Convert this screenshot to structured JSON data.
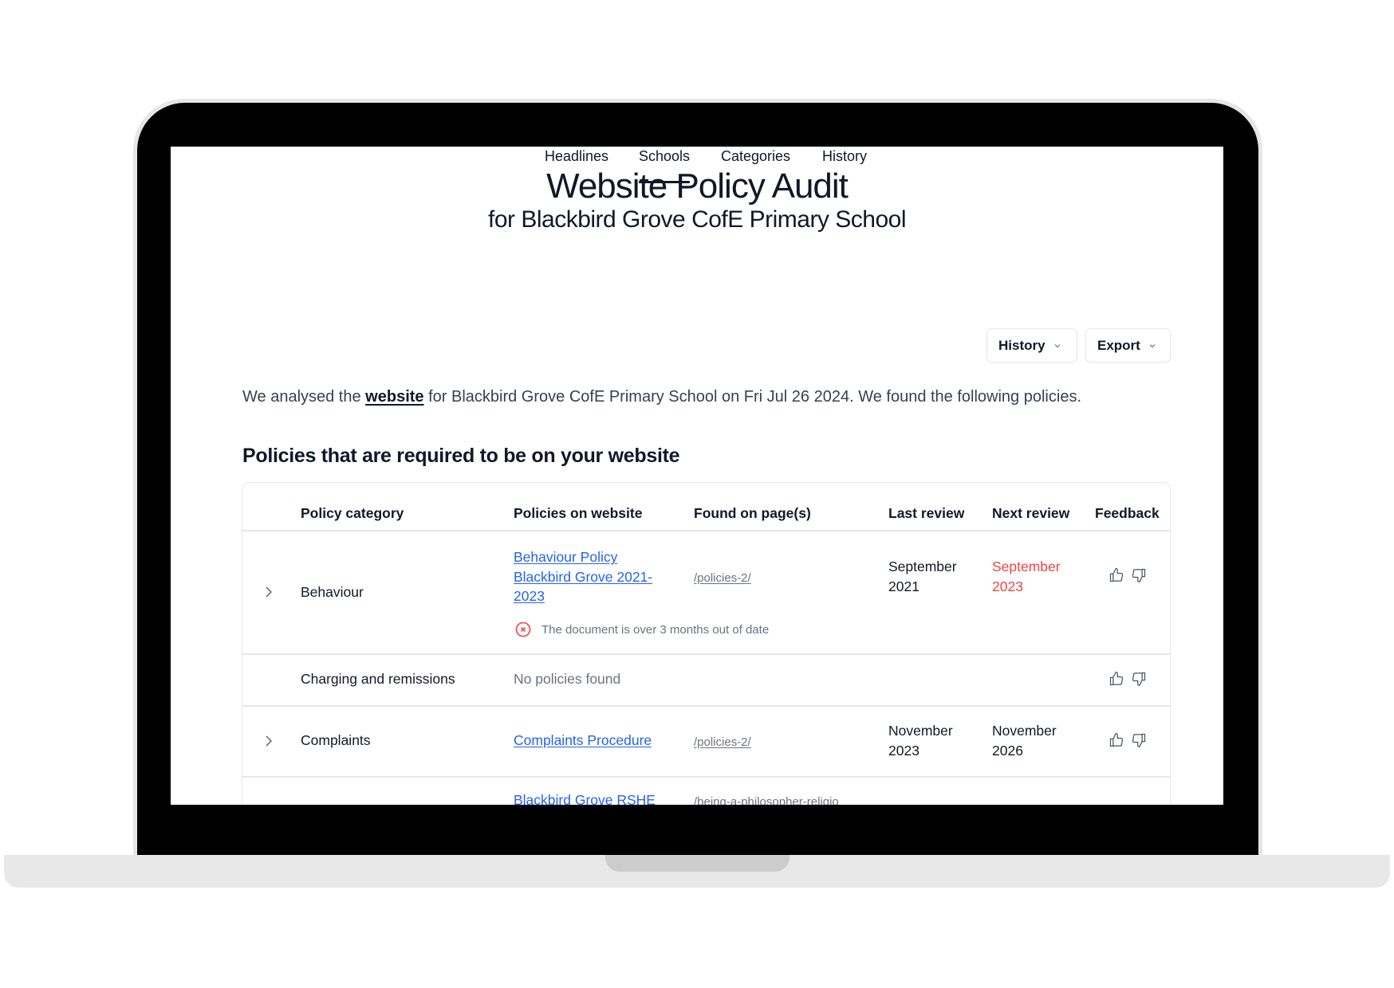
{
  "page": {
    "title": "Website Policy Audit",
    "subtitle": "for Blackbird Grove CofE Primary School"
  },
  "tabs": [
    {
      "label": "Headlines",
      "active": false
    },
    {
      "label": "Schools",
      "active": true
    },
    {
      "label": "Categories",
      "active": false
    },
    {
      "label": "History",
      "active": false
    }
  ],
  "actions": {
    "history_label": "History",
    "export_label": "Export"
  },
  "intro": {
    "before": "We analysed the ",
    "link": "website",
    "after": " for Blackbird Grove CofE Primary School on Fri Jul 26 2024. We found the following policies."
  },
  "section": {
    "title": "Policies that are required to be on your website"
  },
  "table": {
    "headers": [
      "Policy category",
      "Policies on website",
      "Found on page(s)",
      "Last review",
      "Next review",
      "Feedback"
    ],
    "rows": [
      {
        "category": "Behaviour",
        "expandable": true,
        "policy_lines": [
          "Behaviour Policy",
          "Blackbird Grove 2021-",
          "2023"
        ],
        "found_on": "/policies-2/",
        "last_review_lines": [
          "September",
          "2021"
        ],
        "next_review_lines": [
          "September",
          "2023"
        ],
        "next_review_overdue": true,
        "warning": "The document is over 3 months out of date"
      },
      {
        "category": "Charging and remissions",
        "expandable": false,
        "no_policies": "No policies found"
      },
      {
        "category": "Complaints",
        "expandable": true,
        "policy_lines": [
          "Complaints Procedure"
        ],
        "found_on": "/policies-2/",
        "last_review_lines": [
          "November",
          "2023"
        ],
        "next_review_lines": [
          "November",
          "2026"
        ],
        "next_review_overdue": false
      },
      {
        "category": "",
        "expandable": false,
        "policy_lines": [
          "Blackbird Grove RSHE"
        ],
        "found_on": "/being-a-philosopher-religio"
      }
    ]
  },
  "colors": {
    "link": "#2563eb",
    "danger": "#ef4444",
    "text": "#111827",
    "muted": "#6b7280",
    "border": "#e5e7eb"
  },
  "icons": {
    "expand": "chevron-right-icon",
    "dropdown": "chevron-down-icon",
    "warning": "x-circle-icon",
    "thumbs_up": "thumbs-up-icon",
    "thumbs_down": "thumbs-down-icon"
  }
}
